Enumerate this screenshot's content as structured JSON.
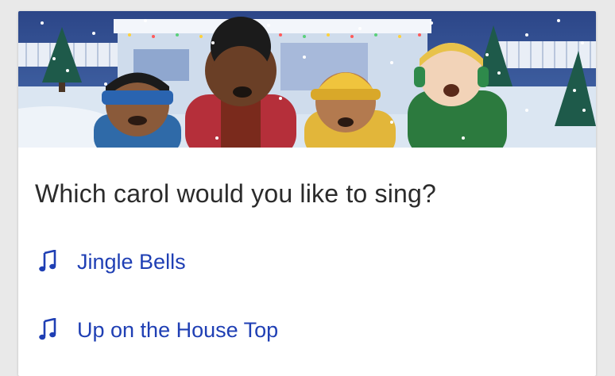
{
  "banner": {
    "icon": "carolers-illustration"
  },
  "prompt": {
    "question": "Which carol would you like to sing?"
  },
  "options": [
    {
      "label": "Jingle Bells",
      "icon": "music-note-icon"
    },
    {
      "label": "Up on the House Top",
      "icon": "music-note-icon"
    }
  ],
  "colors": {
    "link": "#1f3fb4",
    "text": "#2b2b2b",
    "sky": "#2e4a8e"
  }
}
